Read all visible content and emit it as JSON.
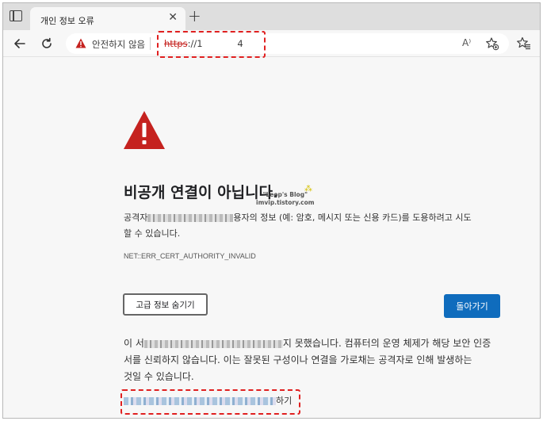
{
  "tab": {
    "title": "개인 정보 오류",
    "close": "✕",
    "new_tab": "+"
  },
  "toolbar": {
    "insecure_label": "안전하지 않음",
    "url_scheme": "https",
    "url_rest": "://1            4",
    "read_aloud": "A⁾"
  },
  "page": {
    "heading": "비공개 연결이 아닙니다.",
    "watermark_line1": "\"Leop's Blog\"",
    "watermark_line2": "imvip.tistory.com",
    "desc_prefix": "공격자",
    "desc_middle": "용자의 정보 (예: 암호, 메시지 또는 신용 카드)를 도용하려고 시도",
    "desc_line2": "할 수 있습니다.",
    "error_code": "NET::ERR_CERT_AUTHORITY_INVALID",
    "advanced_button": "고급 정보 숨기기",
    "back_button": "돌아가기",
    "details_prefix": "이 서",
    "details_middle": "지 못했습니다. 컴퓨터의 운영 체제가 해당 보안 인증",
    "details_line2": "서를 신뢰하지 않습니다. 이는 잘못된 구성이나 연결을 가로채는 공격자로 인해 발생하는",
    "details_line3": "것일 수 있습니다.",
    "proceed_suffix": "하기"
  },
  "colors": {
    "warning_red": "#c5221f",
    "accent_blue": "#0f6cbd",
    "highlight_red": "#e02020"
  },
  "icons": [
    "tab-actions-icon",
    "close-icon",
    "back-arrow-icon",
    "refresh-icon",
    "warning-icon",
    "read-aloud-icon",
    "add-favorite-icon",
    "favorites-icon"
  ]
}
